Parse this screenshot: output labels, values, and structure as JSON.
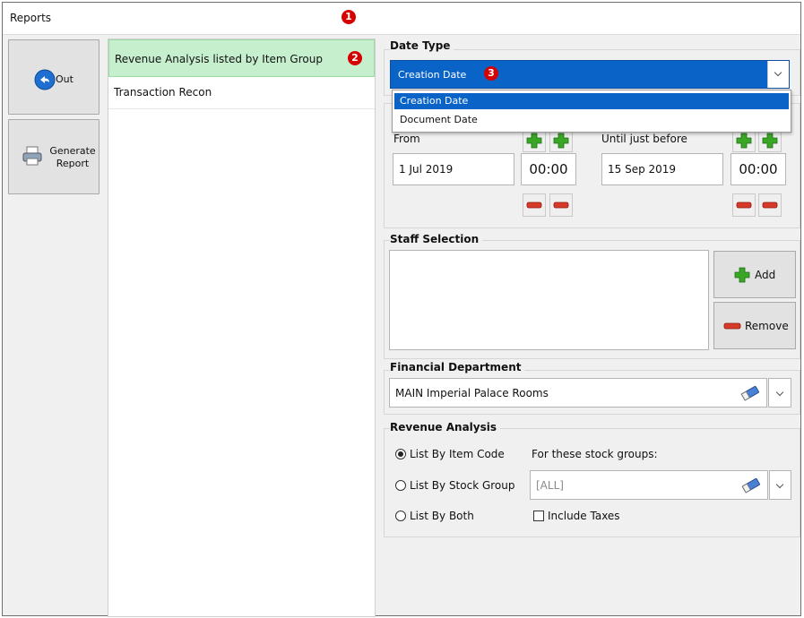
{
  "window": {
    "title": "Reports"
  },
  "markers": [
    "1",
    "2",
    "3"
  ],
  "side_buttons": [
    {
      "label": "Out",
      "icon": "back-arrow-icon"
    },
    {
      "label": "Generate Report",
      "line1": "Generate",
      "line2": "Report",
      "icon": "printer-icon"
    }
  ],
  "report_list": [
    {
      "label": "Revenue Analysis listed by Item Group",
      "selected": true
    },
    {
      "label": "Transaction Recon",
      "selected": false
    }
  ],
  "date_type": {
    "title": "Date Type",
    "selected": "Creation Date",
    "options": [
      "Creation Date",
      "Document Date"
    ]
  },
  "date_range": {
    "from_label": "From",
    "from_date": "1 Jul 2019",
    "from_time": "00:00",
    "until_label": "Until just before",
    "until_date": "15 Sep 2019",
    "until_time": "00:00"
  },
  "staff_selection": {
    "title": "Staff Selection",
    "add_label": "Add",
    "remove_label": "Remove"
  },
  "financial_department": {
    "title": "Financial Department",
    "value": "MAIN Imperial Palace Rooms"
  },
  "revenue_analysis": {
    "title": "Revenue Analysis",
    "options": [
      {
        "label": "List By Item Code",
        "checked": true
      },
      {
        "label": "List By Stock Group",
        "checked": false
      },
      {
        "label": "List By Both",
        "checked": false
      }
    ],
    "stock_groups_label": "For these stock groups:",
    "stock_groups_placeholder": "[ALL]",
    "include_taxes_label": "Include Taxes",
    "include_taxes_checked": false
  },
  "colors": {
    "selection_blue": "#0a64c8",
    "list_selected_green": "#c6efce",
    "marker_red": "#d60000",
    "plus_green": "#3aa626",
    "minus_red": "#d83a2a"
  }
}
